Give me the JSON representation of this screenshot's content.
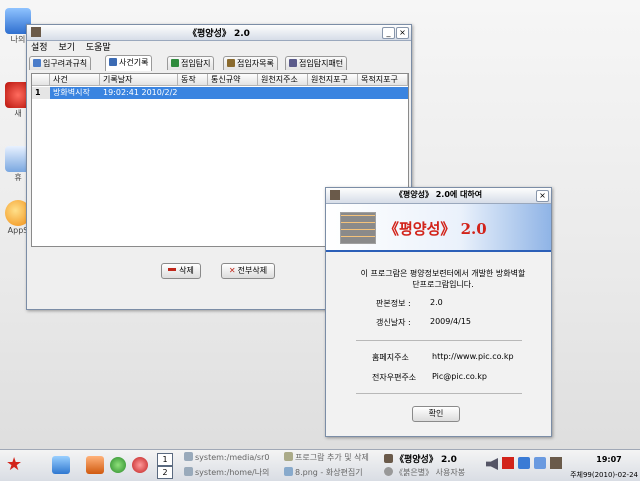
{
  "desktop": {
    "icons": [
      {
        "label": "나의",
        "icon": "computer-icon",
        "color": "#3a7bd5"
      },
      {
        "label": "새",
        "icon": "red-star-icon",
        "color": "#d62a1e"
      },
      {
        "label": "휴",
        "icon": "trash-icon",
        "color": "#7aa7e0"
      },
      {
        "label": "AppS",
        "icon": "app-store-icon",
        "color": "#f0a020"
      }
    ]
  },
  "main_window": {
    "title": "《평양성》 2.0",
    "menu": [
      "설정",
      "보기",
      "도움말"
    ],
    "tabs": [
      {
        "label": "입구려과규칙",
        "icon": "shield-icon"
      },
      {
        "label": "사건기록",
        "icon": "log-icon"
      },
      {
        "label": "접입탐지",
        "icon": "detect-icon"
      },
      {
        "label": "접입자목록",
        "icon": "list-icon"
      },
      {
        "label": "접입탐지패턴",
        "icon": "pattern-icon"
      }
    ],
    "columns": [
      "사건",
      "기록날자",
      "동작",
      "통신규약",
      "원천지주소",
      "원천지포구",
      "목적지포구"
    ],
    "rows": [
      {
        "num": "1",
        "cells": [
          "방화벽시작",
          "19:02:41 2010/2/2",
          "",
          "",
          "",
          "",
          ""
        ]
      }
    ],
    "buttons": {
      "delete": "삭제",
      "delete_all": "전부삭제"
    }
  },
  "about_dialog": {
    "title": "《평양성》 2.0에 대하여",
    "banner_title": "《평양성》 2.0",
    "description": "이 프로그람은 평양정보련터에서 개발한 방화벽할단프로그람입니다.",
    "fields": [
      {
        "label": "판본정보 :",
        "value": "2.0"
      },
      {
        "label": "갱신날자 :",
        "value": "2009/4/15"
      },
      {
        "label": "홈페지주소",
        "value": "http://www.pic.co.kp"
      },
      {
        "label": "전자우편주소",
        "value": "Pic@pic.co.kp"
      }
    ],
    "ok_label": "확인"
  },
  "taskbar": {
    "desktops": [
      "1",
      "2"
    ],
    "tasks": [
      {
        "label": "system:/media/sr0"
      },
      {
        "label": "프로그람 추가 및 삭제"
      },
      {
        "label": "《평양성》 2.0"
      },
      {
        "label": "system:/home/나의"
      },
      {
        "label": "8.png - 화상편집기"
      },
      {
        "label": "《붉은별》 사용자봉"
      }
    ],
    "clock": "19:07",
    "date": "주체99(2010)-02-24"
  }
}
